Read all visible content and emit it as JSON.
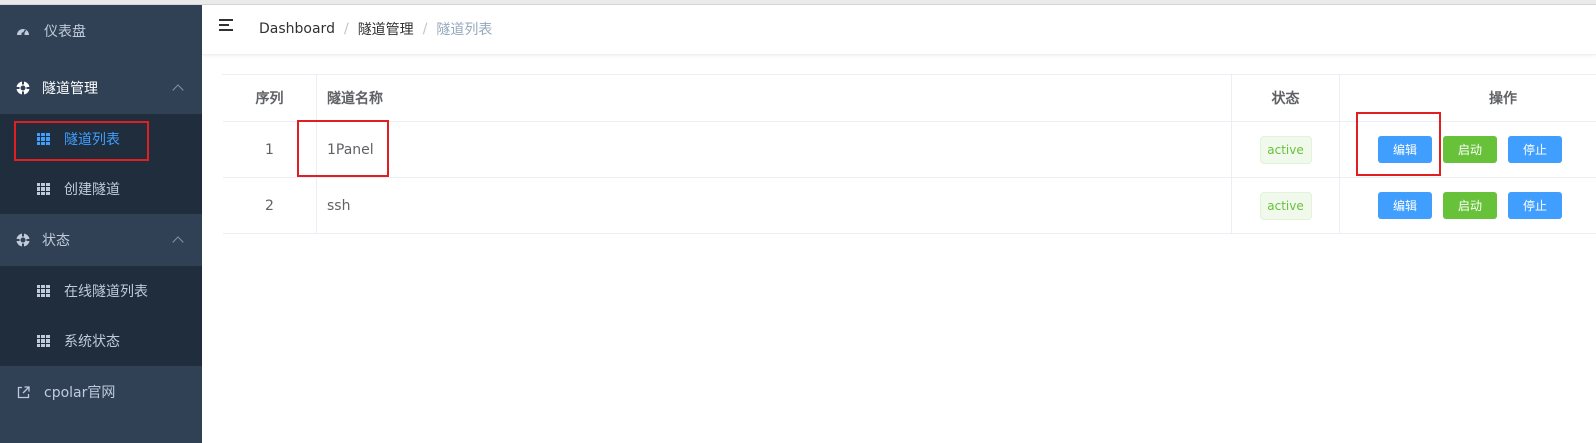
{
  "sidebar": {
    "items": [
      {
        "label": "仪表盘",
        "icon": "dashboard-icon"
      },
      {
        "label": "隧道管理",
        "icon": "settings-circle-icon",
        "expanded": true
      },
      {
        "label": "隧道列表",
        "icon": "table-icon",
        "active": true
      },
      {
        "label": "创建隧道",
        "icon": "table-icon"
      },
      {
        "label": "状态",
        "icon": "settings-circle-icon",
        "expanded": true
      },
      {
        "label": "在线隧道列表",
        "icon": "table-icon"
      },
      {
        "label": "系统状态",
        "icon": "table-icon"
      },
      {
        "label": "cpolar官网",
        "icon": "external-link-icon"
      }
    ]
  },
  "breadcrumb": [
    "Dashboard",
    "隧道管理",
    "隧道列表"
  ],
  "table": {
    "headers": [
      "序列",
      "隧道名称",
      "状态",
      "操作"
    ],
    "rows": [
      {
        "index": "1",
        "name": "1Panel",
        "status": "active"
      },
      {
        "index": "2",
        "name": "ssh",
        "status": "active"
      }
    ],
    "actions": {
      "edit": "编辑",
      "start": "启动",
      "stop": "停止"
    }
  },
  "colors": {
    "sidebar_bg": "#304156",
    "submenu_bg": "#1f2d3d",
    "primary": "#409eff",
    "success": "#67c23a",
    "highlight": "#e02020"
  }
}
